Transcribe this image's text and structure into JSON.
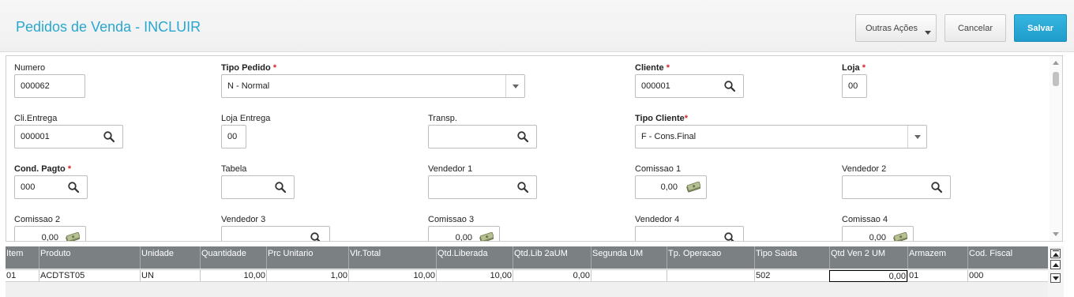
{
  "header": {
    "title": "Pedidos de Venda - INCLUIR",
    "outras_acoes": "Outras Ações",
    "cancelar": "Cancelar",
    "salvar": "Salvar",
    "accent_color": "#29a7d0"
  },
  "form": {
    "numero": {
      "label": "Numero",
      "value": "000062"
    },
    "tipo_pedido": {
      "label": "Tipo Pedido",
      "required": "*",
      "value": "N - Normal"
    },
    "cliente": {
      "label": "Cliente",
      "required": "*",
      "value": "000001"
    },
    "loja": {
      "label": "Loja",
      "required": "*",
      "value": "00"
    },
    "cli_entrega": {
      "label": "Cli.Entrega",
      "value": "000001"
    },
    "loja_entrega": {
      "label": "Loja Entrega",
      "value": "00"
    },
    "transp": {
      "label": "Transp.",
      "value": ""
    },
    "tipo_cliente": {
      "label": "Tipo Cliente",
      "required": "*",
      "value": "F - Cons.Final"
    },
    "cond_pagto": {
      "label": "Cond. Pagto",
      "required": "*",
      "value": "000"
    },
    "tabela": {
      "label": "Tabela",
      "value": ""
    },
    "vendedor1": {
      "label": "Vendedor 1",
      "value": ""
    },
    "comissao1": {
      "label": "Comissao 1",
      "value": "0,00"
    },
    "vendedor2": {
      "label": "Vendedor 2",
      "value": ""
    },
    "comissao2": {
      "label": "Comissao 2",
      "value": "0,00"
    },
    "vendedor3": {
      "label": "Vendedor 3",
      "value": ""
    },
    "comissao3": {
      "label": "Comissao 3",
      "value": "0,00"
    },
    "vendedor4": {
      "label": "Vendedor 4",
      "value": ""
    },
    "comissao4": {
      "label": "Comissao 4",
      "value": "0,00"
    }
  },
  "grid": {
    "columns": [
      "Item",
      "Produto",
      "Unidade",
      "Quantidade",
      "Prc Unitario",
      "Vlr.Total",
      "Qtd.Liberada",
      "Qtd.Lib 2aUM",
      "Segunda UM",
      "Tp. Operacao",
      "Tipo Saida",
      "Qtd Ven 2 UM",
      "Armazem",
      "Cod. Fiscal"
    ],
    "rows": [
      [
        "01",
        "ACDTST05",
        "UN",
        "10,00",
        "1,00",
        "10,00",
        "10,00",
        "0,00",
        "",
        "",
        "502",
        "0,00",
        "01",
        "000"
      ]
    ]
  }
}
